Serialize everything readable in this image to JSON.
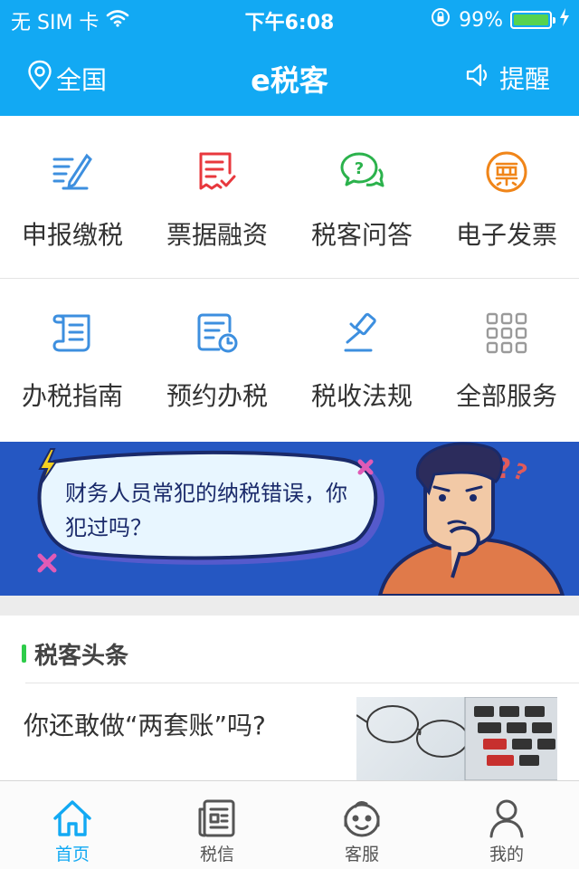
{
  "status_bar": {
    "carrier": "无 SIM 卡",
    "time": "下午6:08",
    "battery_percent": "99%",
    "battery_level": 0.99
  },
  "navbar": {
    "location": "全国",
    "title": "e税客",
    "reminder": "提醒"
  },
  "services": [
    {
      "label": "申报缴税",
      "icon": "declare-tax-icon",
      "color": "#3d8fdf"
    },
    {
      "label": "票据融资",
      "icon": "bill-finance-icon",
      "color": "#e8383d"
    },
    {
      "label": "税客问答",
      "icon": "qa-chat-icon",
      "color": "#2bb24c"
    },
    {
      "label": "电子发票",
      "icon": "e-invoice-icon",
      "color": "#f08519"
    },
    {
      "label": "办税指南",
      "icon": "guide-scroll-icon",
      "color": "#3d8fdf"
    },
    {
      "label": "预约办税",
      "icon": "appointment-clock-icon",
      "color": "#3d8fdf"
    },
    {
      "label": "税收法规",
      "icon": "law-gavel-icon",
      "color": "#3d8fdf"
    },
    {
      "label": "全部服务",
      "icon": "all-services-grid-icon",
      "color": "#9a9a9a"
    }
  ],
  "banner": {
    "text": "财务人员常犯的纳税错误，你犯过吗？",
    "background": "#2557c2"
  },
  "news": {
    "section_title": "税客头条",
    "items": [
      {
        "title": "你还敢做“两套账”吗?"
      }
    ]
  },
  "tabbar": {
    "active_color": "#12a9f3",
    "tabs": [
      {
        "label": "首页",
        "icon": "home-icon",
        "active": true
      },
      {
        "label": "税信",
        "icon": "news-doc-icon",
        "active": false
      },
      {
        "label": "客服",
        "icon": "customer-service-icon",
        "active": false
      },
      {
        "label": "我的",
        "icon": "profile-icon",
        "active": false
      }
    ]
  },
  "colors": {
    "brand": "#12a9f3",
    "accent_green": "#2ecc4a"
  }
}
